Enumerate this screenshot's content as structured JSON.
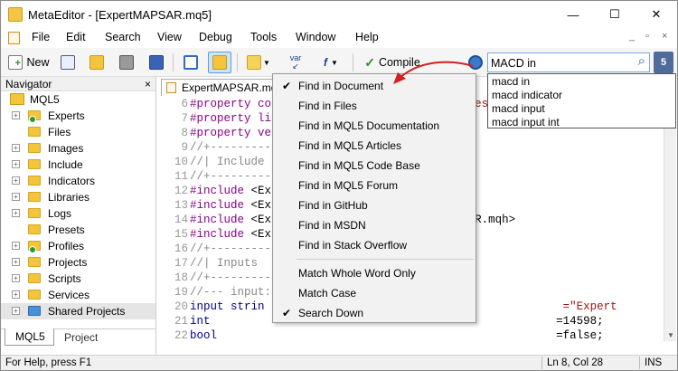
{
  "window": {
    "title": "MetaEditor - [ExpertMAPSAR.mq5]",
    "minimize_glyph": "—",
    "maximize_glyph": "☐",
    "close_glyph": "✕"
  },
  "menu": {
    "items": [
      "File",
      "Edit",
      "Search",
      "View",
      "Debug",
      "Tools",
      "Window",
      "Help"
    ],
    "mdi_controls": [
      "_",
      "▫",
      "×"
    ]
  },
  "toolbar": {
    "new_label": "New",
    "compile_label": "Compile",
    "var_label": "var",
    "f_label": "f",
    "search_value": "MACD in",
    "search_glyph": "⌕",
    "community_glyph": "5"
  },
  "search_suggestions": [
    "macd in",
    "macd indicator",
    "macd input",
    "macd input int"
  ],
  "search_menu": {
    "items": [
      {
        "label": "Find in Document",
        "checked": true
      },
      {
        "label": "Find in Files",
        "checked": false
      },
      {
        "label": "Find in MQL5 Documentation",
        "checked": false
      },
      {
        "label": "Find in MQL5 Articles",
        "checked": false
      },
      {
        "label": "Find in MQL5 Code Base",
        "checked": false
      },
      {
        "label": "Find in MQL5 Forum",
        "checked": false
      },
      {
        "label": "Find in GitHub",
        "checked": false
      },
      {
        "label": "Find in MSDN",
        "checked": false
      },
      {
        "label": "Find in Stack Overflow",
        "checked": false
      }
    ],
    "options": [
      {
        "label": "Match Whole Word Only",
        "checked": false
      },
      {
        "label": "Match Case",
        "checked": false
      },
      {
        "label": "Search Down",
        "checked": true
      }
    ],
    "check_glyph": "✔"
  },
  "navigator": {
    "title": "Navigator",
    "close_glyph": "×",
    "root": "MQL5",
    "items": [
      {
        "label": "Experts",
        "expandable": true,
        "badge": "green"
      },
      {
        "label": "Files",
        "expandable": false
      },
      {
        "label": "Images",
        "expandable": true
      },
      {
        "label": "Include",
        "expandable": true
      },
      {
        "label": "Indicators",
        "expandable": true
      },
      {
        "label": "Libraries",
        "expandable": true
      },
      {
        "label": "Logs",
        "expandable": true
      },
      {
        "label": "Presets",
        "expandable": false
      },
      {
        "label": "Profiles",
        "expandable": true,
        "badge": "green"
      },
      {
        "label": "Projects",
        "expandable": true
      },
      {
        "label": "Scripts",
        "expandable": true
      },
      {
        "label": "Services",
        "expandable": true
      },
      {
        "label": "Shared Projects",
        "expandable": true,
        "badge": "blue"
      }
    ],
    "tabs": [
      "MQL5",
      "Project"
    ]
  },
  "editor": {
    "tab_label": "ExpertMAPSAR.mq5",
    "tab_close": "×",
    "lines": [
      {
        "n": "6",
        "parts": [
          [
            "k1",
            "#property co"
          ],
          [
            "",
            "                              "
          ],
          [
            "st",
            "es"
          ]
        ]
      },
      {
        "n": "7",
        "parts": [
          [
            "k1",
            "#property li"
          ]
        ]
      },
      {
        "n": "8",
        "parts": [
          [
            "k1",
            "#property ve"
          ]
        ]
      },
      {
        "n": "9",
        "parts": [
          [
            "cm",
            "//+----------"
          ]
        ]
      },
      {
        "n": "10",
        "parts": [
          [
            "cm",
            "//| Include"
          ]
        ]
      },
      {
        "n": "11",
        "parts": [
          [
            "cm",
            "//+----------"
          ]
        ]
      },
      {
        "n": "12",
        "parts": [
          [
            "k1",
            "#include "
          ],
          [
            "",
            "<Ex"
          ]
        ]
      },
      {
        "n": "13",
        "parts": [
          [
            "k1",
            "#include "
          ],
          [
            "",
            "<Ex"
          ]
        ]
      },
      {
        "n": "14",
        "parts": [
          [
            "k1",
            "#include "
          ],
          [
            "",
            "<Ex"
          ],
          [
            "",
            "                         licSAR.mqh>"
          ]
        ]
      },
      {
        "n": "15",
        "parts": [
          [
            "k1",
            "#include "
          ],
          [
            "",
            "<Ex"
          ]
        ]
      },
      {
        "n": "16",
        "parts": [
          [
            "cm",
            "//+----------"
          ]
        ]
      },
      {
        "n": "17",
        "parts": [
          [
            "cm",
            "//| Inputs"
          ]
        ]
      },
      {
        "n": "18",
        "parts": [
          [
            "cm",
            "//+----------"
          ]
        ]
      },
      {
        "n": "19",
        "parts": [
          [
            "cm",
            "//--- input:"
          ]
        ]
      },
      {
        "n": "20",
        "parts": [
          [
            "k2",
            "input strin"
          ],
          [
            "",
            "                          "
          ],
          [
            "st",
            "e                 =\"Expert"
          ]
        ]
      },
      {
        "n": "21",
        "parts": [
          [
            "k2",
            "int"
          ],
          [
            "",
            "                                                   =14598;"
          ]
        ]
      },
      {
        "n": "22",
        "parts": [
          [
            "k2",
            "bool"
          ],
          [
            "",
            "                                                  =false;"
          ]
        ]
      }
    ]
  },
  "status": {
    "help_text": "For Help, press F1",
    "position": "Ln 8, Col 28",
    "mode": "INS"
  },
  "colors": {
    "accent": "#0078d7",
    "folder": "#f2c53d",
    "selection": "#cce4f7",
    "arrow": "#d32020"
  }
}
